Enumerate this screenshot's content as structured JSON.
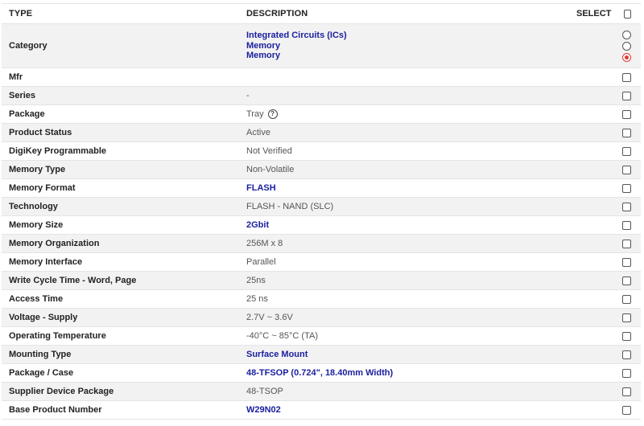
{
  "header": {
    "type": "TYPE",
    "description": "DESCRIPTION",
    "select": "SELECT"
  },
  "category": {
    "label": "Category",
    "values": [
      "Integrated Circuits (ICs)",
      "Memory",
      "Memory"
    ],
    "selected_index": 2
  },
  "rows": [
    {
      "type": "Mfr",
      "desc": "",
      "link": false
    },
    {
      "type": "Series",
      "desc": "-",
      "link": false
    },
    {
      "type": "Package",
      "desc": "Tray",
      "link": false,
      "help_icon": "question-circle-icon"
    },
    {
      "type": "Product Status",
      "desc": "Active",
      "link": false
    },
    {
      "type": "DigiKey Programmable",
      "desc": "Not Verified",
      "link": false
    },
    {
      "type": "Memory Type",
      "desc": "Non-Volatile",
      "link": false
    },
    {
      "type": "Memory Format",
      "desc": "FLASH",
      "link": true
    },
    {
      "type": "Technology",
      "desc": "FLASH - NAND (SLC)",
      "link": false
    },
    {
      "type": "Memory Size",
      "desc": "2Gbit",
      "link": true
    },
    {
      "type": "Memory Organization",
      "desc": "256M x 8",
      "link": false
    },
    {
      "type": "Memory Interface",
      "desc": "Parallel",
      "link": false
    },
    {
      "type": "Write Cycle Time - Word, Page",
      "desc": "25ns",
      "link": false
    },
    {
      "type": "Access Time",
      "desc": "25 ns",
      "link": false
    },
    {
      "type": "Voltage - Supply",
      "desc": "2.7V ~ 3.6V",
      "link": false
    },
    {
      "type": "Operating Temperature",
      "desc": "-40°C ~ 85°C (TA)",
      "link": false
    },
    {
      "type": "Mounting Type",
      "desc": "Surface Mount",
      "link": true
    },
    {
      "type": "Package / Case",
      "desc": "48-TFSOP (0.724\", 18.40mm Width)",
      "link": true
    },
    {
      "type": "Supplier Device Package",
      "desc": "48-TSOP",
      "link": false
    },
    {
      "type": "Base Product Number",
      "desc": "W29N02",
      "link": true
    }
  ],
  "colors": {
    "link": "#1a1f9e",
    "radio_selected": "#e53935",
    "row_alt": "#f2f2f2"
  }
}
